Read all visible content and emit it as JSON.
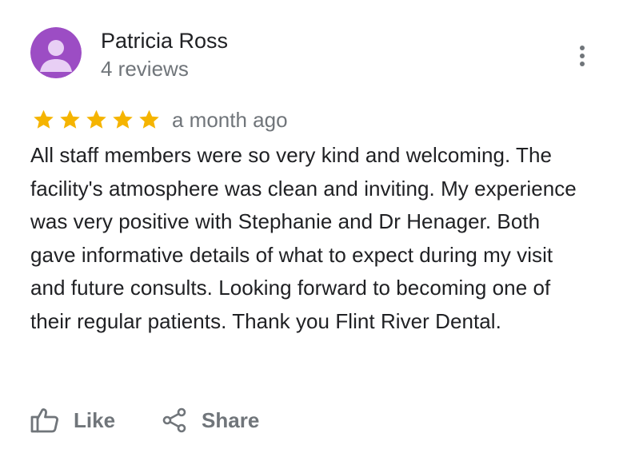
{
  "reviewer": {
    "name": "Patricia Ross",
    "review_count": "4 reviews",
    "avatar_icon": "person-icon",
    "avatar_color": "#9c4dc4"
  },
  "review": {
    "rating": 5,
    "rating_max": 5,
    "star_color": "#f5b400",
    "timestamp": "a month ago",
    "text": "All staff members were so very kind and welcoming. The facility's atmosphere was clean and inviting. My experience was very positive with Stephanie and Dr Henager. Both gave informative details of what to expect during my visit and future consults. Looking forward to becoming one of their regular patients. Thank you Flint River Dental."
  },
  "actions": {
    "like_label": "Like",
    "like_icon": "thumbs-up-icon",
    "share_label": "Share",
    "share_icon": "share-icon",
    "more_icon": "more-vert-icon"
  },
  "colors": {
    "primary_text": "#202124",
    "secondary_text": "#70757a"
  }
}
